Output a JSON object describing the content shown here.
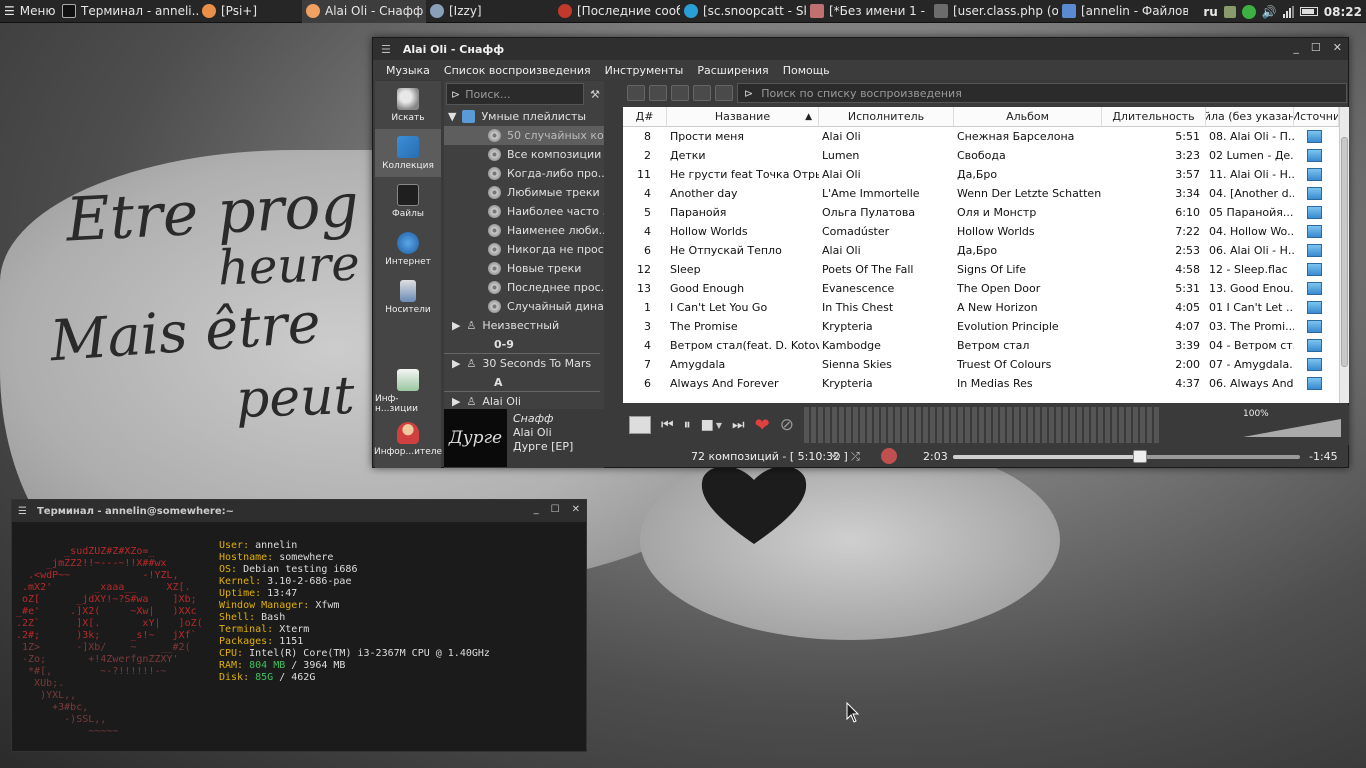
{
  "desktop": {
    "paper_text": [
      "Etre prog",
      "heure",
      "Mais être",
      "peut"
    ]
  },
  "taskbar": {
    "menu_label": "Меню",
    "items": [
      {
        "label": "Терминал - anneli...",
        "color": "#6b9fd6"
      },
      {
        "label": "[Psi+]",
        "color": "#e88f4a"
      },
      {
        "label": "Alai Oli - Снафф",
        "color": "#f0a060",
        "active": true
      },
      {
        "label": "[Izzy]",
        "color": "#8aa0b8"
      },
      {
        "label": "[Последние сооб...",
        "color": "#c0392b"
      },
      {
        "label": "[sc.snoopcatt - Sky...",
        "color": "#2a9fd6"
      },
      {
        "label": "[*Без имени 1 - ...",
        "color": "#c07070"
      },
      {
        "label": "[user.class.php (o...",
        "color": "#6c6c6c"
      },
      {
        "label": "[annelin - Файлов...",
        "color": "#5a8ad0"
      }
    ],
    "tray": {
      "layout": "ru",
      "time": "08:22"
    }
  },
  "player": {
    "window_title": "Alai Oli - Снафф",
    "menu": [
      "Музыка",
      "Список воспроизведения",
      "Инструменты",
      "Расширения",
      "Помощь"
    ],
    "sidebar": [
      {
        "label": "Искать",
        "icon": "search-icon"
      },
      {
        "label": "Коллекция",
        "icon": "music-note-icon",
        "selected": true
      },
      {
        "label": "Файлы",
        "icon": "folder-icon"
      },
      {
        "label": "Интернет",
        "icon": "globe-icon"
      },
      {
        "label": "Носители",
        "icon": "device-icon"
      },
      {
        "label": "Инф-н...зиции",
        "icon": "song-info-icon"
      },
      {
        "label": "Инфор...ителе",
        "icon": "artist-info-icon"
      }
    ],
    "library_search_placeholder": "Поиск...",
    "smart_header": "Умные плейлисты",
    "smart_playlists": [
      "50 случайных ко...",
      "Все композиции",
      "Когда-либо про...",
      "Любимые треки",
      "Наиболее часто ...",
      "Наименее люби...",
      "Никогда не прос...",
      "Новые треки",
      "Последнее прос...",
      "Случайный дина..."
    ],
    "artists": [
      {
        "name": "Неизвестный",
        "divider": "0-9"
      },
      {
        "name": "30 Seconds To Mars",
        "divider": "A"
      },
      {
        "name": "Alai Oli",
        "divider": ""
      }
    ],
    "now_playing": {
      "cover_text": "Дурге",
      "title": "Снафф",
      "artist": "Alai Oli",
      "album": "Дурге [EP]"
    },
    "playlist_search_placeholder": "Поиск по списку воспроизведения",
    "columns": [
      "Д#",
      "Название",
      "Исполнитель",
      "Альбом",
      "Длительность",
      "йла (без указан",
      "Источни"
    ],
    "tracks": [
      {
        "n": "8",
        "title": "Прости меня",
        "artist": "Alai Oli",
        "album": "Снежная Барселона",
        "len": "5:51",
        "file": "08. Alai Oli - П..."
      },
      {
        "n": "2",
        "title": "Детки",
        "artist": "Lumen",
        "album": "Свобода",
        "len": "3:23",
        "file": "02 Lumen - Де..."
      },
      {
        "n": "11",
        "title": "Не грусти feat Точка Отрыва",
        "artist": "Alai Oli",
        "album": "Да,Бро",
        "len": "3:57",
        "file": "11. Alai Oli - Н..."
      },
      {
        "n": "4",
        "title": "Another day",
        "artist": "L'Ame Immortelle",
        "album": "Wenn Der Letzte Schatten ...",
        "len": "3:34",
        "file": "04. [Another d..."
      },
      {
        "n": "5",
        "title": "Паранойя",
        "artist": "Ольга Пулатова",
        "album": "Оля и Монстр",
        "len": "6:10",
        "file": "05 Паранойя...."
      },
      {
        "n": "4",
        "title": "Hollow Worlds",
        "artist": "Comadúster",
        "album": "Hollow Worlds",
        "len": "7:22",
        "file": "04. Hollow Wo..."
      },
      {
        "n": "6",
        "title": "Не Отпускай Тепло",
        "artist": "Alai Oli",
        "album": "Да,Бро",
        "len": "2:53",
        "file": "06. Alai Oli - Н..."
      },
      {
        "n": "12",
        "title": "Sleep",
        "artist": "Poets Of The Fall",
        "album": "Signs Of Life",
        "len": "4:58",
        "file": "12 - Sleep.flac"
      },
      {
        "n": "13",
        "title": "Good Enough",
        "artist": "Evanescence",
        "album": "The Open Door",
        "len": "5:31",
        "file": "13. Good Enou..."
      },
      {
        "n": "1",
        "title": "I Can't Let You Go",
        "artist": "In This Chest",
        "album": "A New Horizon",
        "len": "4:05",
        "file": "01 I Can't Let ..."
      },
      {
        "n": "3",
        "title": "The Promise",
        "artist": "Krypteria",
        "album": "Evolution Principle",
        "len": "4:07",
        "file": "03. The Promi..."
      },
      {
        "n": "4",
        "title": "Ветром стал(feat. D. Kotov)",
        "artist": "Kambodge",
        "album": "Ветром стал",
        "len": "3:39",
        "file": "04 - Ветром ст..."
      },
      {
        "n": "7",
        "title": "Amygdala",
        "artist": "Sienna Skies",
        "album": "Truest Of Colours",
        "len": "2:00",
        "file": "07 - Amygdala...."
      },
      {
        "n": "6",
        "title": "Always And Forever",
        "artist": "Krypteria",
        "album": "In Medias Res",
        "len": "4:37",
        "file": "06. Always And..."
      }
    ],
    "volume": "100%",
    "summary": "72 композиций - [ 5:10:32 ]",
    "elapsed": "2:03",
    "remaining": "-1:45",
    "progress": 0.54
  },
  "terminal": {
    "title": "Терминал - annelin@somewhere:~",
    "logo": [
      "        _sudZUZ#Z#XZo=_",
      "     _jmZZ2!!~---~!!X##wx",
      "  .<wdP~~            -!YZL,",
      " .mX2'       _xaaa__     XZ[.",
      " oZ[      _jdXY!~?S#wa    ]Xb;",
      "_#e'     .]X2(     ~Xw|   )XXc",
      ".2Z`      ]X[.       xY|   ]oZ(",
      ".2#;      )3k;     _s!~   jXf`"
    ],
    "logo_dim": [
      " 1Z>      -]Xb/    ~    __#2(",
      " -Zo;       +!4ZwerfgnZZXY'",
      "  *#[,        ~-?!!!!!!-~",
      "   XUb;.",
      "    )YXL,,",
      "      +3#bc,",
      "        -)SSL,,",
      "            ~~~~~"
    ],
    "info": [
      {
        "k": "User:",
        "v": " annelin"
      },
      {
        "k": "Hostname:",
        "v": " somewhere"
      },
      {
        "k": "OS:",
        "v": " Debian testing i686"
      },
      {
        "k": "Kernel:",
        "v": " 3.10-2-686-pae"
      },
      {
        "k": "Uptime:",
        "v": " 13:47"
      },
      {
        "k": "Window Manager:",
        "v": " Xfwm"
      },
      {
        "k": "Shell:",
        "v": " Bash"
      },
      {
        "k": "Terminal:",
        "v": " Xterm"
      },
      {
        "k": "Packages:",
        "v": " 1151"
      },
      {
        "k": "CPU:",
        "v": " Intel(R) Core(TM) i3-2367M CPU @ 1.40GHz"
      }
    ],
    "ram": {
      "used": "804 MB",
      "total": " / 3964 MB"
    },
    "disk": {
      "used": "85G",
      "total": " / 462G"
    }
  }
}
